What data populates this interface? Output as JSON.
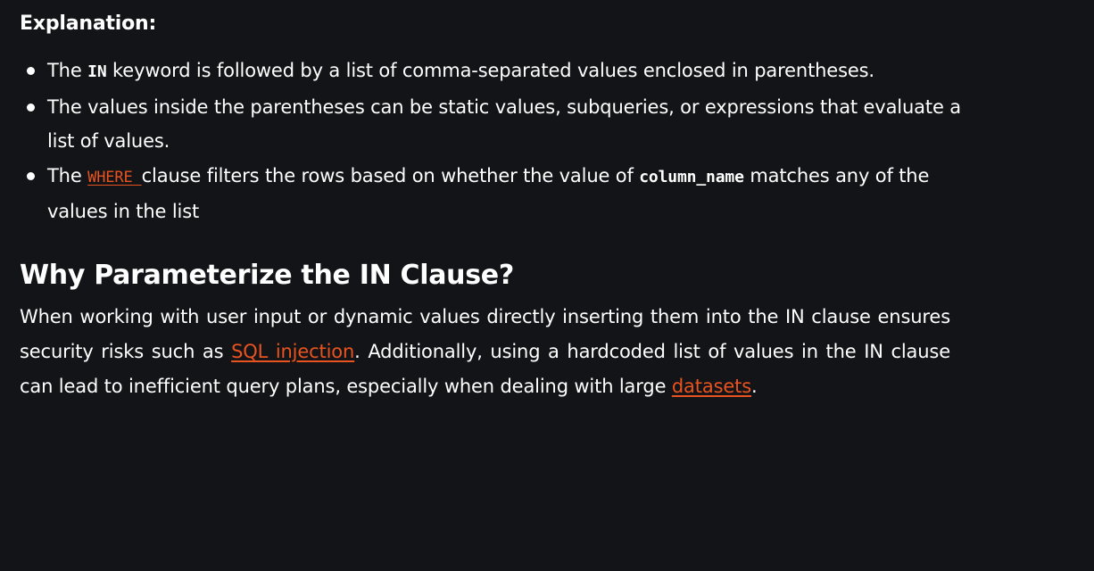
{
  "explanation": {
    "heading": "Explanation:",
    "bullets": [
      {
        "prefix": "The ",
        "code": "IN",
        "suffix": " keyword is followed by a list of comma-separated values enclosed in parentheses."
      },
      {
        "text": "The values inside the parentheses can be static values, subqueries, or expressions that evaluate a list of values."
      },
      {
        "prefix": "The ",
        "link": "WHERE ",
        "middle": "clause filters the rows based on whether the value of ",
        "code": "column_name",
        "suffix": " matches any of the values in the list"
      }
    ]
  },
  "section": {
    "heading": "Why Parameterize the IN Clause?",
    "paragraph": {
      "part1": "When working with user input or dynamic values directly inserting them into the IN clause ensures security risks such as ",
      "link1": "SQL injection",
      "part2": ". Additionally, using a hardcoded list of values in the IN clause can lead to inefficient query plans, especially when dealing with large ",
      "link2": "datasets",
      "part3": "."
    }
  },
  "colors": {
    "background": "#131417",
    "text": "#ffffff",
    "link": "#e8531f"
  }
}
